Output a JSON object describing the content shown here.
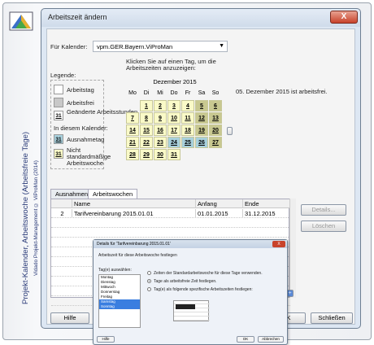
{
  "side": {
    "title": "Projekt-Kalender, Arbeitswoche (Arbeitsfreie Tage)",
    "subtitle": "Vidado Projekt-Management © ViProMan (2014)"
  },
  "window": {
    "title": "Arbeitszeit ändern",
    "close": "X"
  },
  "calendar_select": {
    "label": "Für Kalender:",
    "value": "vpm.GER.Bayern.ViProMan"
  },
  "legend": {
    "title": "Legende:",
    "items": [
      "Arbeitstag",
      "Arbeitsfrei",
      "Geänderte Arbeitsstunden"
    ],
    "section": "In diesem Kalender:",
    "items2": [
      "Ausnahmetag",
      "Nicht standardmäßige Arbeitswoche"
    ],
    "num": "31"
  },
  "instruction": "Klicken Sie auf einen Tag, um die Arbeitszeiten anzuzeigen:",
  "month": "Dezember 2015",
  "info": "05. Dezember 2015 ist arbeitsfrei.",
  "weekdays": [
    "Mo",
    "Di",
    "Mi",
    "Do",
    "Fr",
    "Sa",
    "So"
  ],
  "days": [
    "",
    "1",
    "2",
    "3",
    "4",
    "5",
    "6",
    "7",
    "8",
    "9",
    "10",
    "11",
    "12",
    "13",
    "14",
    "15",
    "16",
    "17",
    "18",
    "19",
    "20",
    "21",
    "22",
    "23",
    "24",
    "25",
    "26",
    "27",
    "28",
    "29",
    "30",
    "31",
    "",
    "",
    ""
  ],
  "tabs": [
    "Ausnahmen",
    "Arbeitswochen"
  ],
  "table": {
    "headers": [
      "",
      "Name",
      "Anfang",
      "Ende"
    ],
    "row": [
      "2",
      "Tarifvereinbarung 2015.01.01",
      "01.01.2015",
      "31.12.2015"
    ]
  },
  "buttons": {
    "details": "Details...",
    "delete": "Löschen",
    "help": "Hilfe",
    "ok": "OK",
    "close": "Schließen"
  },
  "sub": {
    "title": "Details für 'Tarifvereinbarung 2015.01.01'",
    "group": "Arbeitszeit für diese Arbeitswoche festlegen",
    "pick": "Tag(e) auswählen:",
    "days": [
      "Montag",
      "Dienstag",
      "Mittwoch",
      "Donnerstag",
      "Freitag",
      "Samstag",
      "Sonntag"
    ],
    "opts": [
      "Zeiten der Standardarbeitswoche für diese Tage verwenden.",
      "Tage als arbeitsfreie Zeit festlegen.",
      "Tag(e) als folgende spezifische Arbeitszeiten festlegen:"
    ],
    "ok": "OK",
    "cancel": "Abbrechen",
    "help": "Hilfe"
  }
}
